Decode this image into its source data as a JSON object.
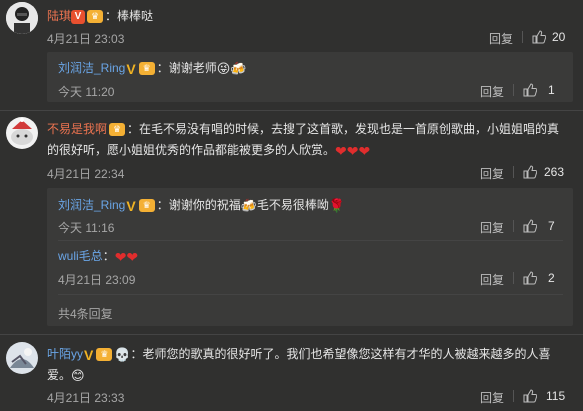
{
  "comments": [
    {
      "user": "陆琪",
      "text": "：棒棒哒",
      "date": "4月21日 23:03",
      "reply": "回复",
      "likes": "20",
      "sub": [
        {
          "user": "刘润洁_Ring",
          "text": "：谢谢老师",
          "date": "今天 11:20",
          "reply": "回复",
          "likes": "1"
        }
      ]
    },
    {
      "user": "不易是我啊",
      "text_line1": "：在毛不易没有唱的时候，去搜了这首歌，发现也是一首原创歌曲，小姐姐唱的真",
      "text_line2": "的很好听，愿小姐姐优秀的作品都能被更多的人欣赏。",
      "date": "4月21日 22:34",
      "reply": "回复",
      "likes": "263",
      "sub": [
        {
          "user": "刘润洁_Ring",
          "text_a": "：谢谢你的祝福",
          "text_b": "毛不易很棒呦",
          "date": "今天 11:16",
          "reply": "回复",
          "likes": "7"
        },
        {
          "user": "wuli毛总",
          "text": "：",
          "date": "4月21日 23:09",
          "reply": "回复",
          "likes": "2"
        }
      ],
      "more": "共4条回复"
    },
    {
      "user": "叶陌yy",
      "text_line1": "：老师您的歌真的很好听了。我们也希望像您这样有才华的人被越来越多的人喜",
      "text_line2": "爱。",
      "date": "4月21日 23:33",
      "reply": "回复",
      "likes": "115"
    }
  ],
  "icons": {
    "verified": "verified-v-icon",
    "crown": "member-crown-icon",
    "thumb": "thumbs-up-icon",
    "heart": "heart-emoji",
    "rose": "rose-emoji",
    "beer": "beer-emoji",
    "wink": "wink-emoji",
    "smile": "smile-emoji",
    "skull": "skull-emoji"
  },
  "colors": {
    "background": "#30302f",
    "username_orange": "#eb7350",
    "username_blue": "#6aa5e6"
  }
}
